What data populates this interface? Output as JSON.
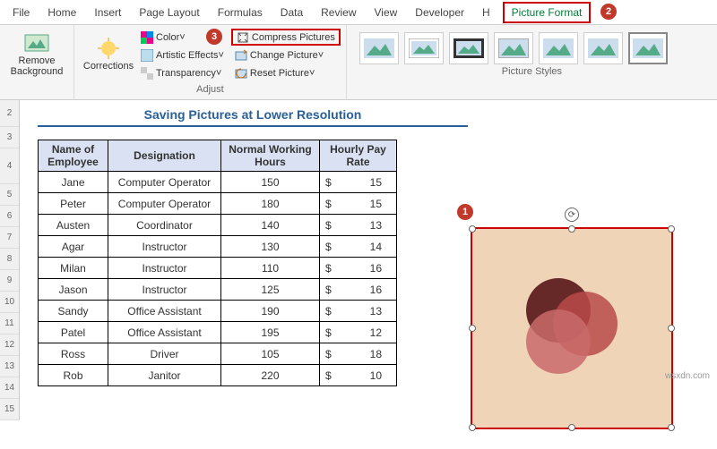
{
  "tabs": [
    "File",
    "Home",
    "Insert",
    "Page Layout",
    "Formulas",
    "Data",
    "Review",
    "View",
    "Developer",
    "H"
  ],
  "picture_format": "Picture Format",
  "ribbon": {
    "remove_bg": "Remove\nBackground",
    "corrections": "Corrections",
    "color": "Color",
    "artistic": "Artistic Effects",
    "transparency": "Transparency",
    "compress": "Compress Pictures",
    "change": "Change Picture",
    "reset": "Reset Picture",
    "group_adjust": "Adjust",
    "group_styles": "Picture Styles"
  },
  "title": "Saving Pictures at Lower Resolution",
  "cols": {
    "c1": "Name of Employee",
    "c2": "Designation",
    "c3": "Normal Working Hours",
    "c4": "Hourly Pay Rate"
  },
  "rows": [
    {
      "n": "Jane",
      "d": "Computer Operator",
      "h": "150",
      "p": "15"
    },
    {
      "n": "Peter",
      "d": "Computer Operator",
      "h": "180",
      "p": "15"
    },
    {
      "n": "Austen",
      "d": "Coordinator",
      "h": "140",
      "p": "13"
    },
    {
      "n": "Agar",
      "d": "Instructor",
      "h": "130",
      "p": "14"
    },
    {
      "n": "Milan",
      "d": "Instructor",
      "h": "110",
      "p": "16"
    },
    {
      "n": "Jason",
      "d": "Instructor",
      "h": "125",
      "p": "16"
    },
    {
      "n": "Sandy",
      "d": "Office Assistant",
      "h": "190",
      "p": "13"
    },
    {
      "n": "Patel",
      "d": "Office Assistant",
      "h": "195",
      "p": "12"
    },
    {
      "n": "Ross",
      "d": "Driver",
      "h": "105",
      "p": "18"
    },
    {
      "n": "Rob",
      "d": "Janitor",
      "h": "220",
      "p": "10"
    }
  ],
  "rownums": [
    "2",
    "3",
    "4",
    "5",
    "6",
    "7",
    "8",
    "9",
    "10",
    "11",
    "12",
    "13",
    "14",
    "15"
  ],
  "currency": "$",
  "badges": {
    "b1": "1",
    "b2": "2",
    "b3": "3"
  },
  "watermark": "wsxdn.com"
}
